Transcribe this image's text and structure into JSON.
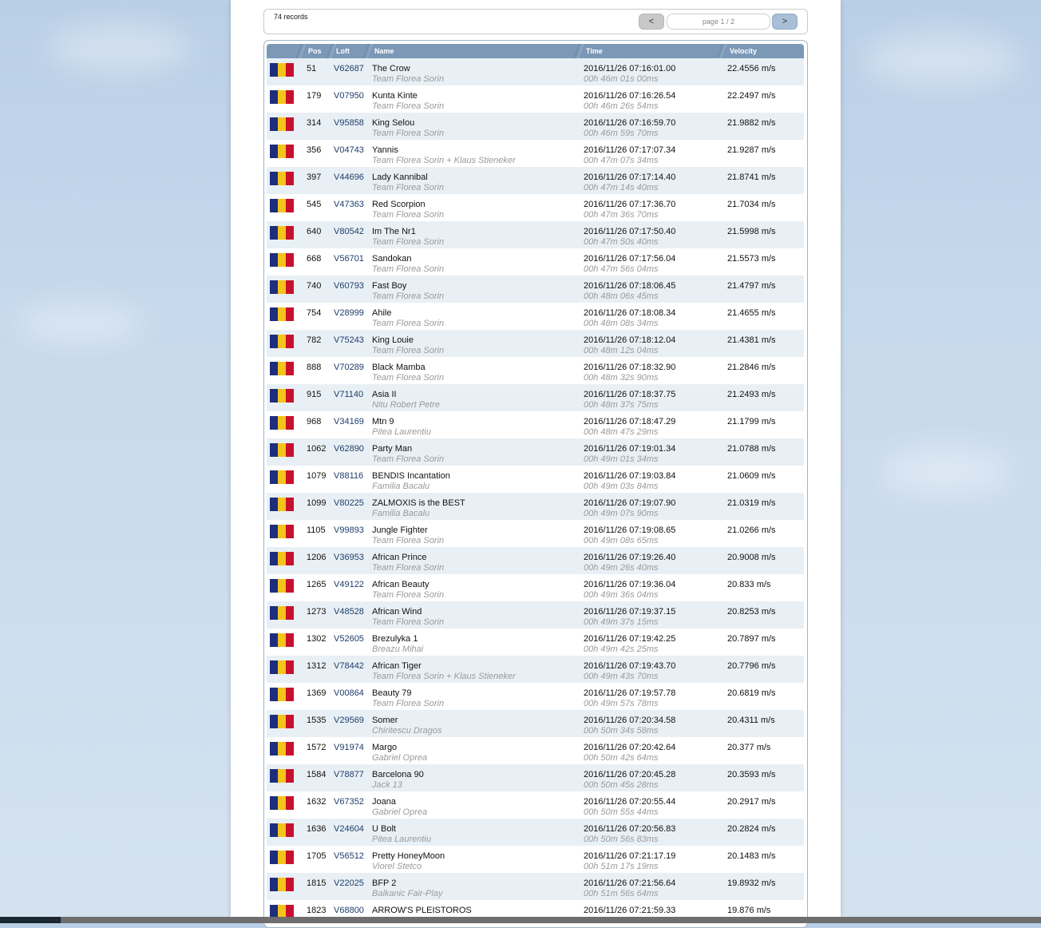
{
  "pagination": {
    "records_label": "74 records",
    "prev_label": "<",
    "next_label": ">",
    "page_label": "page 1 / 2"
  },
  "table": {
    "headers": [
      "Pos",
      "Loft",
      "Name",
      "Time",
      "Velocity"
    ],
    "flag_colors": [
      "#1e2e7c",
      "#f3c41a",
      "#c8102e"
    ],
    "rows": [
      {
        "pos": "51",
        "loft": "V62687",
        "name": "The Crow",
        "team": "Team Florea Sorin",
        "time": "2016/11/26 07:16:01.00",
        "duration": "00h 46m 01s 00ms",
        "velocity": "22.4556 m/s"
      },
      {
        "pos": "179",
        "loft": "V07950",
        "name": "Kunta Kinte",
        "team": "Team Florea Sorin",
        "time": "2016/11/26 07:16:26.54",
        "duration": "00h 46m 26s 54ms",
        "velocity": "22.2497 m/s"
      },
      {
        "pos": "314",
        "loft": "V95858",
        "name": "King Selou",
        "team": "Team Florea Sorin",
        "time": "2016/11/26 07:16:59.70",
        "duration": "00h 46m 59s 70ms",
        "velocity": "21.9882 m/s"
      },
      {
        "pos": "356",
        "loft": "V04743",
        "name": "Yannis",
        "team": "Team Florea Sorin + Klaus Stieneker",
        "time": "2016/11/26 07:17:07.34",
        "duration": "00h 47m 07s 34ms",
        "velocity": "21.9287 m/s"
      },
      {
        "pos": "397",
        "loft": "V44696",
        "name": "Lady Kannibal",
        "team": "Team Florea Sorin",
        "time": "2016/11/26 07:17:14.40",
        "duration": "00h 47m 14s 40ms",
        "velocity": "21.8741 m/s"
      },
      {
        "pos": "545",
        "loft": "V47363",
        "name": "Red Scorpion",
        "team": "Team Florea Sorin",
        "time": "2016/11/26 07:17:36.70",
        "duration": "00h 47m 36s 70ms",
        "velocity": "21.7034 m/s"
      },
      {
        "pos": "640",
        "loft": "V80542",
        "name": "Im The Nr1",
        "team": "Team Florea Sorin",
        "time": "2016/11/26 07:17:50.40",
        "duration": "00h 47m 50s 40ms",
        "velocity": "21.5998 m/s"
      },
      {
        "pos": "668",
        "loft": "V56701",
        "name": "Sandokan",
        "team": "Team Florea Sorin",
        "time": "2016/11/26 07:17:56.04",
        "duration": "00h 47m 56s 04ms",
        "velocity": "21.5573 m/s"
      },
      {
        "pos": "740",
        "loft": "V60793",
        "name": "Fast Boy",
        "team": "Team Florea Sorin",
        "time": "2016/11/26 07:18:06.45",
        "duration": "00h 48m 06s 45ms",
        "velocity": "21.4797 m/s"
      },
      {
        "pos": "754",
        "loft": "V28999",
        "name": "Ahile",
        "team": "Team Florea Sorin",
        "time": "2016/11/26 07:18:08.34",
        "duration": "00h 48m 08s 34ms",
        "velocity": "21.4655 m/s"
      },
      {
        "pos": "782",
        "loft": "V75243",
        "name": "King Louie",
        "team": "Team Florea Sorin",
        "time": "2016/11/26 07:18:12.04",
        "duration": "00h 48m 12s 04ms",
        "velocity": "21.4381 m/s"
      },
      {
        "pos": "888",
        "loft": "V70289",
        "name": "Black Mamba",
        "team": "Team Florea Sorin",
        "time": "2016/11/26 07:18:32.90",
        "duration": "00h 48m 32s 90ms",
        "velocity": "21.2846 m/s"
      },
      {
        "pos": "915",
        "loft": "V71140",
        "name": "Asia II",
        "team": "Nitu Robert Petre",
        "time": "2016/11/26 07:18:37.75",
        "duration": "00h 48m 37s 75ms",
        "velocity": "21.2493 m/s"
      },
      {
        "pos": "968",
        "loft": "V34169",
        "name": "Mtn 9",
        "team": "Pitea Laurentiu",
        "time": "2016/11/26 07:18:47.29",
        "duration": "00h 48m 47s 29ms",
        "velocity": "21.1799 m/s"
      },
      {
        "pos": "1062",
        "loft": "V62890",
        "name": "Party Man",
        "team": "Team Florea Sorin",
        "time": "2016/11/26 07:19:01.34",
        "duration": "00h 49m 01s 34ms",
        "velocity": "21.0788 m/s"
      },
      {
        "pos": "1079",
        "loft": "V88116",
        "name": "BENDIS Incantation",
        "team": "Familia Bacalu",
        "time": "2016/11/26 07:19:03.84",
        "duration": "00h 49m 03s 84ms",
        "velocity": "21.0609 m/s"
      },
      {
        "pos": "1099",
        "loft": "V80225",
        "name": "ZALMOXIS is the BEST",
        "team": "Familia Bacalu",
        "time": "2016/11/26 07:19:07.90",
        "duration": "00h 49m 07s 90ms",
        "velocity": "21.0319 m/s"
      },
      {
        "pos": "1105",
        "loft": "V99893",
        "name": "Jungle Fighter",
        "team": "Team Florea Sorin",
        "time": "2016/11/26 07:19:08.65",
        "duration": "00h 49m 08s 65ms",
        "velocity": "21.0266 m/s"
      },
      {
        "pos": "1206",
        "loft": "V36953",
        "name": "African Prince",
        "team": "Team Florea Sorin",
        "time": "2016/11/26 07:19:26.40",
        "duration": "00h 49m 26s 40ms",
        "velocity": "20.9008 m/s"
      },
      {
        "pos": "1265",
        "loft": "V49122",
        "name": "African Beauty",
        "team": "Team Florea Sorin",
        "time": "2016/11/26 07:19:36.04",
        "duration": "00h 49m 36s 04ms",
        "velocity": "20.833 m/s"
      },
      {
        "pos": "1273",
        "loft": "V48528",
        "name": "African Wind",
        "team": "Team Florea Sorin",
        "time": "2016/11/26 07:19:37.15",
        "duration": "00h 49m 37s 15ms",
        "velocity": "20.8253 m/s"
      },
      {
        "pos": "1302",
        "loft": "V52605",
        "name": "Brezulyka 1",
        "team": "Breazu Mihai",
        "time": "2016/11/26 07:19:42.25",
        "duration": "00h 49m 42s 25ms",
        "velocity": "20.7897 m/s"
      },
      {
        "pos": "1312",
        "loft": "V78442",
        "name": "African Tiger",
        "team": "Team Florea Sorin + Klaus Stieneker",
        "time": "2016/11/26 07:19:43.70",
        "duration": "00h 49m 43s 70ms",
        "velocity": "20.7796 m/s"
      },
      {
        "pos": "1369",
        "loft": "V00864",
        "name": "Beauty 79",
        "team": "Team Florea Sorin",
        "time": "2016/11/26 07:19:57.78",
        "duration": "00h 49m 57s 78ms",
        "velocity": "20.6819 m/s"
      },
      {
        "pos": "1535",
        "loft": "V29569",
        "name": "Somer",
        "team": "Chiritescu Dragos",
        "time": "2016/11/26 07:20:34.58",
        "duration": "00h 50m 34s 58ms",
        "velocity": "20.4311 m/s"
      },
      {
        "pos": "1572",
        "loft": "V91974",
        "name": "Margo",
        "team": "Gabriel Oprea",
        "time": "2016/11/26 07:20:42.64",
        "duration": "00h 50m 42s 64ms",
        "velocity": "20.377 m/s"
      },
      {
        "pos": "1584",
        "loft": "V78877",
        "name": "Barcelona 90",
        "team": "Jack 13",
        "time": "2016/11/26 07:20:45.28",
        "duration": "00h 50m 45s 28ms",
        "velocity": "20.3593 m/s"
      },
      {
        "pos": "1632",
        "loft": "V67352",
        "name": "Joana",
        "team": "Gabriel Oprea",
        "time": "2016/11/26 07:20:55.44",
        "duration": "00h 50m 55s 44ms",
        "velocity": "20.2917 m/s"
      },
      {
        "pos": "1636",
        "loft": "V24604",
        "name": "U Bolt",
        "team": "Pitea Laurentiu",
        "time": "2016/11/26 07:20:56.83",
        "duration": "00h 50m 56s 83ms",
        "velocity": "20.2824 m/s"
      },
      {
        "pos": "1705",
        "loft": "V56512",
        "name": "Pretty HoneyMoon",
        "team": "Viorel Stetco",
        "time": "2016/11/26 07:21:17.19",
        "duration": "00h 51m 17s 19ms",
        "velocity": "20.1483 m/s"
      },
      {
        "pos": "1815",
        "loft": "V22025",
        "name": "BFP 2",
        "team": "Balkanic Fair-Play",
        "time": "2016/11/26 07:21:56.64",
        "duration": "00h 51m 56s 64ms",
        "velocity": "19.8932 m/s"
      },
      {
        "pos": "1823",
        "loft": "V68800",
        "name": "ARROW'S PLEISTOROS",
        "team": "",
        "time": "2016/11/26 07:21:59.33",
        "duration": "",
        "velocity": "19.876 m/s"
      }
    ]
  }
}
